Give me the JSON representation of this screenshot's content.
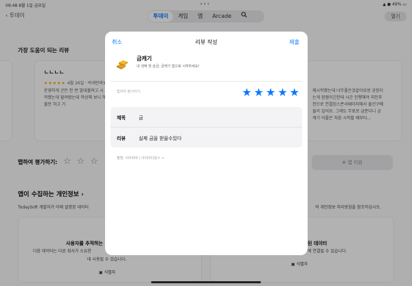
{
  "status": {
    "time": "09:48",
    "date": "8월 1일 금요일",
    "dots": "•••",
    "battery": "49%"
  },
  "header": {
    "back_label": "투데이",
    "tabs": [
      {
        "label": "투데이"
      },
      {
        "label": "게임"
      },
      {
        "label": "앱"
      },
      {
        "label": "Arcade"
      }
    ],
    "open_label": "열기"
  },
  "background": {
    "reviews_title": "가장 도움이 되는 리뷰",
    "review": {
      "title": "ㄴㄴㄴㄴ",
      "stars": "★★★★★",
      "meta": "4월 26일 · 박세란바보",
      "body": "운영하게 곤든 한 번 발대볼려고 시작했는데 할려렀는데 막상해 보니 해볼만 하고 기"
    },
    "right_review_body": "제시작했는데 너무좋은것같아요방 공된다는게 장점이긴한데 시간 진행해야 지인추천으로 연결된스폰서페이지에서 물건구매 들이 있어요. 그래도 무료로 금준다니 금캐기 어플은 처음 시작할 때부터...",
    "rate_label": "탭하여 평가하기:",
    "rate_stars": "☆☆☆",
    "support_label": "앱 지원",
    "privacy_title": "앱이 수집하는 개인정보 ›",
    "privacy_sub": "TodaySoft 개발자가 아래 설명된 데이터",
    "privacy_sub_right": "의 개인정보 처리방침을 참조하십시오.",
    "card_left": {
      "title": "사용자를 추적하는",
      "text1": "다음 데이터는 다른 회사가 소유한",
      "text2": "데 사용될 수 있습니다.",
      "tag": "식별자"
    },
    "card_right": {
      "title": "된 데이터",
      "text1": "에 연결될 수 있습니다.",
      "tag": "식별자"
    }
  },
  "modal": {
    "cancel_label": "취소",
    "title": "리뷰 작성",
    "submit_label": "제출",
    "app_name": "금캐기",
    "app_desc": "내 생애 첫 순금, 금캐기 앱으로 시작하세요!",
    "rate_prompt": "탭하여 평가하기:",
    "stars": "★★★★★",
    "title_label": "제목",
    "title_value": "금",
    "review_label": "리뷰",
    "review_value": "실제 금을 받을수있다",
    "nickname": "별명: 이이야야 ) 이이이디당ㅇ >",
    "accent_color": "#0a7aff"
  }
}
